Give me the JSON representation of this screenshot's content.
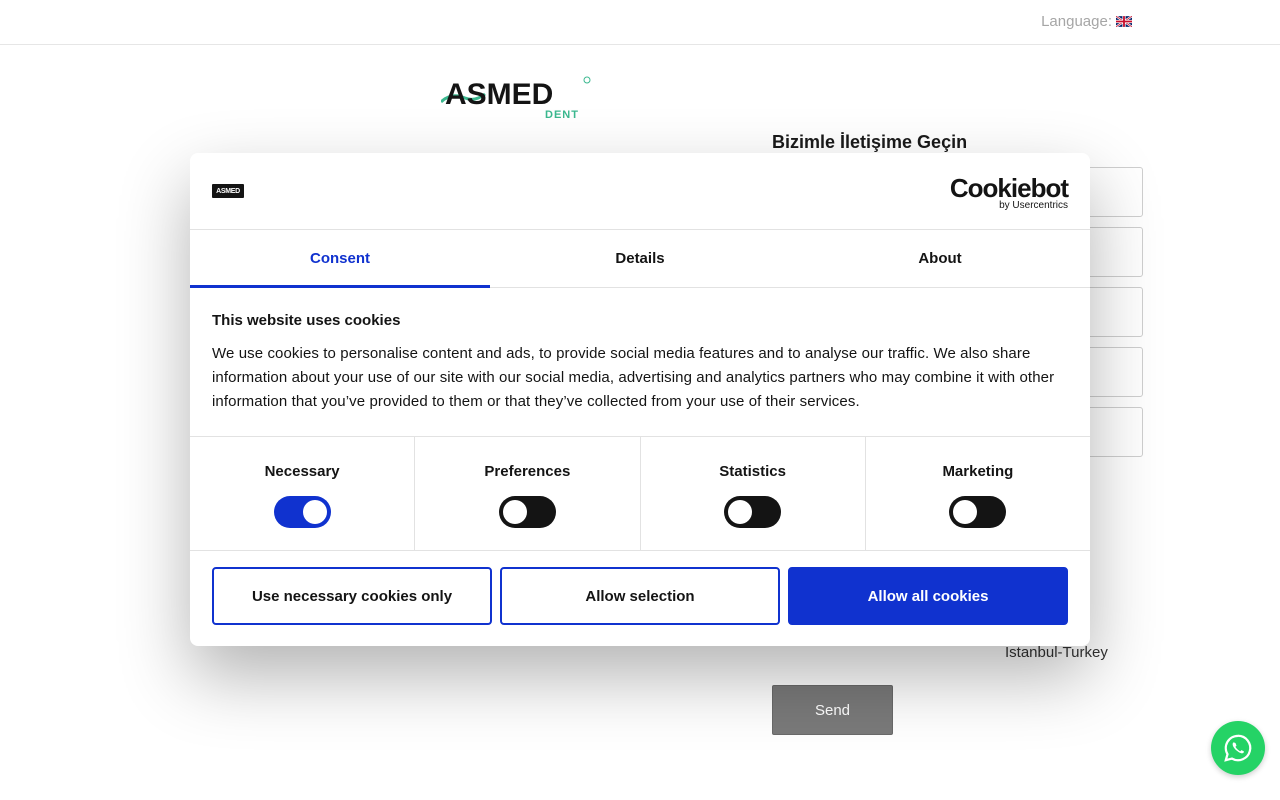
{
  "header": {
    "language_label": "Language:",
    "flag_icon": "uk-flag-icon"
  },
  "brand": {
    "logo_main": "ASMED",
    "logo_sub": "DENT",
    "colors": {
      "dark": "#141414",
      "green": "#3bb88f"
    }
  },
  "contact": {
    "title": "Bizimle İletişime Geçin",
    "address_line": "Istanbul-Turkey",
    "send_label": "Send"
  },
  "whatsapp": {
    "icon": "whatsapp-icon",
    "color": "#25d366"
  },
  "cookie_dialog": {
    "logo_text": "ASMED",
    "provider": "Cookiebot",
    "provider_sub": "by Usercentrics",
    "tabs": [
      {
        "label": "Consent",
        "active": true
      },
      {
        "label": "Details",
        "active": false
      },
      {
        "label": "About",
        "active": false
      }
    ],
    "heading": "This website uses cookies",
    "body": "We use cookies to personalise content and ads, to provide social media features and to analyse our traffic. We also share information about your use of our site with our social media, advertising and analytics partners who may combine it with other information that you’ve provided to them or that they’ve collected from your use of their services.",
    "categories": [
      {
        "label": "Necessary",
        "enabled": true
      },
      {
        "label": "Preferences",
        "enabled": false
      },
      {
        "label": "Statistics",
        "enabled": false
      },
      {
        "label": "Marketing",
        "enabled": false
      }
    ],
    "buttons": {
      "necessary_only": "Use necessary cookies only",
      "allow_selection": "Allow selection",
      "allow_all": "Allow all cookies"
    },
    "accent_color": "#1032cf"
  }
}
